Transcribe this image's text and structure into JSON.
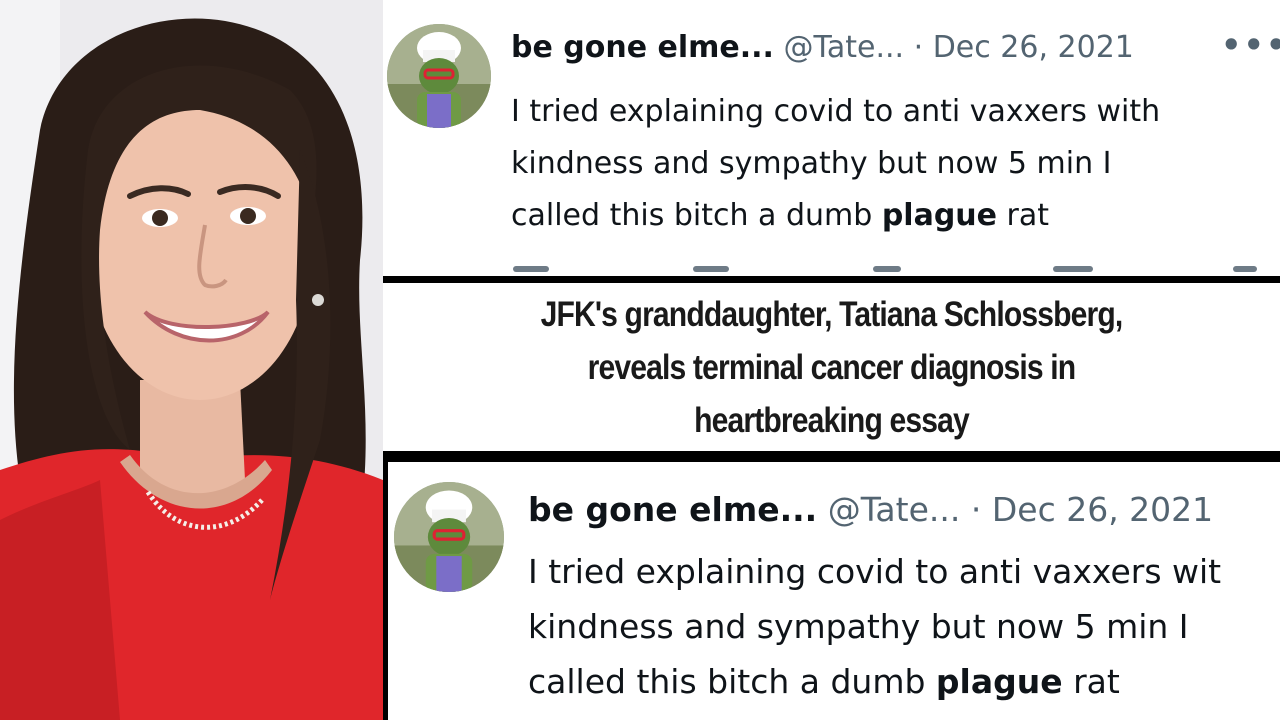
{
  "tweets": [
    {
      "display_name": "be gone elme...",
      "handle": "@Tate...",
      "separator": "·",
      "date": "Dec 26, 2021",
      "more": "•••",
      "text_lines": [
        "I tried explaining covid to anti vaxxers with",
        "kindness and sympathy but now 5 min I"
      ],
      "last_line_prefix": "called this bitch a dumb ",
      "last_line_bold": "plague",
      "last_line_suffix": " rat"
    },
    {
      "display_name": "be gone elme...",
      "handle": "@Tate...",
      "separator": "·",
      "date": "Dec 26, 2021",
      "text_lines": [
        "I tried explaining covid to anti vaxxers wit",
        "kindness and sympathy but now 5 min I"
      ],
      "last_line_prefix": "called this bitch a dumb ",
      "last_line_bold": "plague",
      "last_line_suffix": " rat"
    }
  ],
  "headline": {
    "lines": [
      "JFK's granddaughter, Tatiana Schlossberg,",
      "reveals terminal cancer diagnosis in",
      "heartbreaking essay"
    ]
  },
  "colors": {
    "background": "#000000",
    "card": "#ffffff",
    "text": "#0f1419",
    "muted": "#536471",
    "dress": "#e0262b"
  }
}
